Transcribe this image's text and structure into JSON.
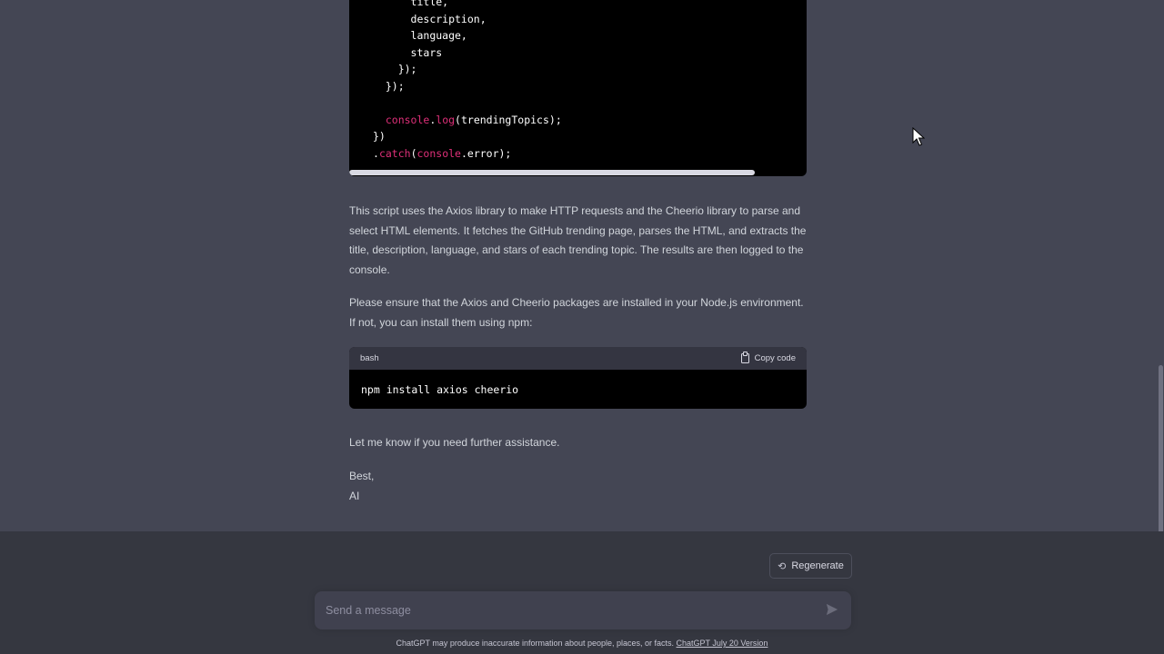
{
  "code_top": {
    "lines": [
      {
        "indent": "      ",
        "parts": [
          {
            "t": "title,",
            "c": "white"
          }
        ]
      },
      {
        "indent": "      ",
        "parts": [
          {
            "t": "description,",
            "c": "white"
          }
        ]
      },
      {
        "indent": "      ",
        "parts": [
          {
            "t": "language,",
            "c": "white"
          }
        ]
      },
      {
        "indent": "      ",
        "parts": [
          {
            "t": "stars",
            "c": "white"
          }
        ]
      },
      {
        "indent": "    ",
        "parts": [
          {
            "t": "});",
            "c": "white"
          }
        ]
      },
      {
        "indent": "  ",
        "parts": [
          {
            "t": "});",
            "c": "white"
          }
        ]
      },
      {
        "indent": "",
        "parts": []
      },
      {
        "indent": "  ",
        "parts": [
          {
            "t": "console",
            "c": "red"
          },
          {
            "t": ".",
            "c": "white"
          },
          {
            "t": "log",
            "c": "red"
          },
          {
            "t": "(trendingTopics);",
            "c": "white"
          }
        ]
      },
      {
        "indent": "",
        "parts": [
          {
            "t": "})",
            "c": "white"
          }
        ]
      },
      {
        "indent": "",
        "parts": [
          {
            "t": ".",
            "c": "white"
          },
          {
            "t": "catch",
            "c": "red"
          },
          {
            "t": "(",
            "c": "white"
          },
          {
            "t": "console",
            "c": "red"
          },
          {
            "t": ".error);",
            "c": "white"
          }
        ]
      }
    ]
  },
  "messages": {
    "p1": "This script uses the Axios library to make HTTP requests and the Cheerio library to parse and select HTML elements. It fetches the GitHub trending page, parses the HTML, and extracts the title, description, language, and stars of each trending topic. The results are then logged to the console.",
    "p2": "Please ensure that the Axios and Cheerio packages are installed in your Node.js environment. If not, you can install them using npm:",
    "p3": "Let me know if you need further assistance.",
    "sign_best": "Best,",
    "sign_name": "AI"
  },
  "bash_block": {
    "language": "bash",
    "copy_label": "Copy code",
    "code": "npm install axios cheerio"
  },
  "bottom": {
    "regenerate_label": "Regenerate",
    "input_placeholder": "Send a message",
    "footer_text": "ChatGPT may produce inaccurate information about people, places, or facts. ",
    "footer_link": "ChatGPT July 20 Version"
  },
  "colors": {
    "background": "#444654",
    "code_bg": "#000000",
    "token_red": "#df3079",
    "bottom_bg": "#353740"
  }
}
